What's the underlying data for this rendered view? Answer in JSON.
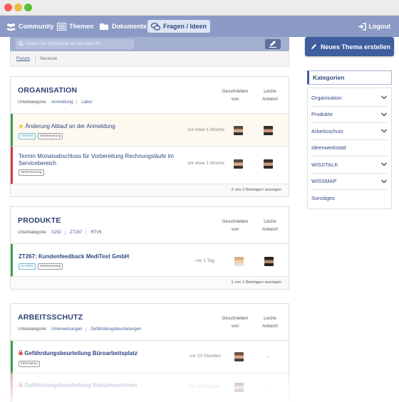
{
  "nav": {
    "community": "Community",
    "themen": "Themen",
    "dokumente": "Dokumente",
    "fragen": "Fragen / Ideen",
    "logout": "Logout"
  },
  "search": {
    "placeholder": "Geben Sie Stichwörter ein um nach ihn"
  },
  "tabs": {
    "forum": "Forum",
    "neueste": "Neueste"
  },
  "columns": {
    "written_1": "Geschrieben",
    "written_2": "von",
    "last_1": "Letzte",
    "last_2": "Antwort"
  },
  "subcat_label": "Unterkategorie:",
  "sections": [
    {
      "title": "ORGANISATION",
      "subcats": [
        "Anmeldung",
        "Labor"
      ],
      "topics": [
        {
          "title": "Änderung Ablauf an der Anmeldung",
          "tags": [
            "Vorhand",
            "Verbesserung"
          ],
          "time": "vor etwa 1 Woche"
        },
        {
          "title": "Termin Monatsabschluss für Vorbereitung Rechnungsläufe im Servicebereich",
          "tags": [
            "Verbesserung"
          ],
          "time": "vor etwa 1 Woche"
        }
      ],
      "footer": "2 von 2 Beiträgen anzeigen"
    },
    {
      "title": "PRODUKTE",
      "subcats": [
        "X252",
        "ZT267",
        "RTV6"
      ],
      "topics": [
        {
          "title": "ZT267: Kundenfeedback MediTest GmbH",
          "tags": [
            "In Arbeit",
            "Verbesserung"
          ],
          "time": "vor 1 Tag"
        }
      ],
      "footer": "1 von 1 Beiträgen anzeigen"
    },
    {
      "title": "ARBEITSSCHUTZ",
      "subcats": [
        "Unterweisungen",
        "Gefährdungsbeurteilungen"
      ],
      "topics": [
        {
          "title": "Gefährdungsbeurteilung Büroarbeitsplatz",
          "tags": [
            "Information"
          ],
          "time": "vor 23 Stunden",
          "last": "-"
        },
        {
          "title": "Gefährdungsbeurteilung Stanzmaschinen",
          "time": "vor 23 Stunden",
          "last": "-"
        }
      ]
    }
  ],
  "sidebar": {
    "new_topic": "Neues Thema erstellen",
    "categories_title": "Kategorien",
    "categories": [
      "Organisation",
      "Produkte",
      "Arbeitsschutz",
      "Ideenwerkstatt",
      "WISSTALK",
      "WISSMAP",
      "Sonstiges"
    ]
  },
  "colors": {
    "nav": "#8b9bc6",
    "accent": "#3f5e9e",
    "green": "#3aa24a",
    "red": "#d23a3a"
  },
  "icons": [
    "community-icon",
    "themen-icon",
    "dokumente-icon",
    "fragen-icon",
    "logout-icon",
    "search-icon",
    "pencil-icon",
    "star-icon",
    "lock-icon",
    "chevron-down-icon"
  ]
}
